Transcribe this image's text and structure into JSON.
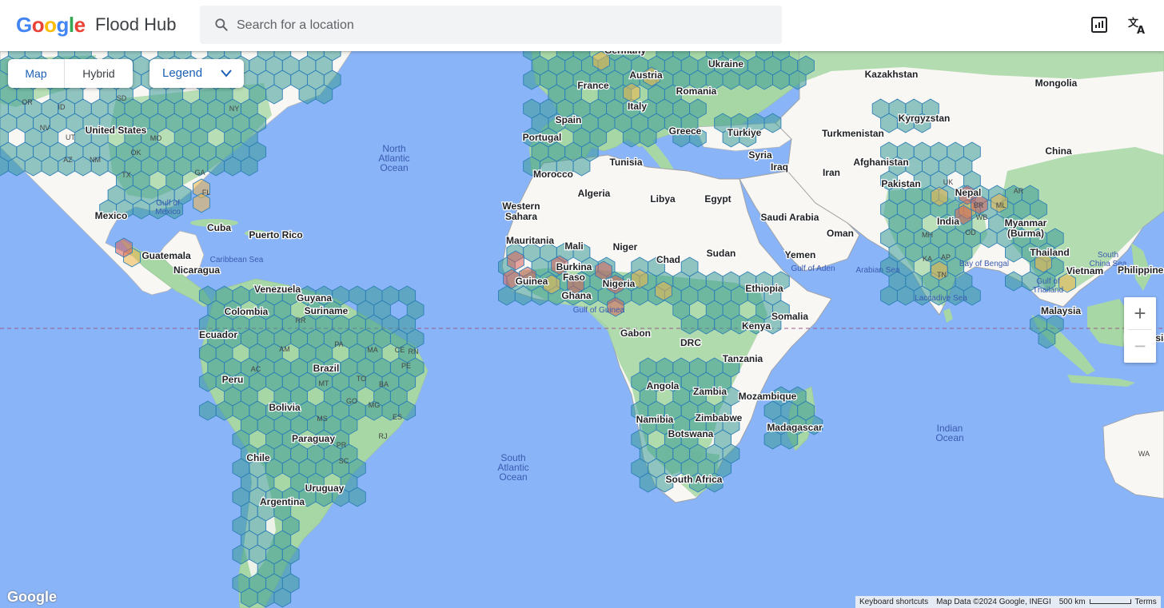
{
  "header": {
    "logo_letters": [
      "G",
      "o",
      "o",
      "g",
      "l",
      "e"
    ],
    "logo_colors": [
      "#4285F4",
      "#EA4335",
      "#FBBC05",
      "#4285F4",
      "#34A853",
      "#EA4335"
    ],
    "product_name": "Flood Hub",
    "search_placeholder": "Search for a location",
    "icons": {
      "search": "search-icon",
      "report": "report-icon",
      "translate": "translate-icon"
    }
  },
  "map_controls": {
    "map_type_options": [
      "Map",
      "Hybrid"
    ],
    "selected_map_type": "Map",
    "legend_label": "Legend",
    "zoom_in_label": "+",
    "zoom_out_label": "−"
  },
  "map_labels": {
    "oceans": [
      "North Atlantic Ocean",
      "South Atlantic Ocean",
      "Indian Ocean"
    ],
    "seas": [
      "Gulf of Mexico",
      "Caribbean Sea",
      "Gulf of Guinea",
      "Arabian Sea",
      "Bay of Bengal",
      "Laccadive Sea",
      "Gulf of Aden",
      "South China Sea",
      "Gulf of Thailand"
    ],
    "countries": [
      "Germany",
      "Ukraine",
      "Kazakhstan",
      "Mongolia",
      "France",
      "Austria",
      "Romania",
      "Italy",
      "Kyrgyzstan",
      "Spain",
      "Portugal",
      "Greece",
      "Türkiye",
      "Turkmenistan",
      "China",
      "Syria",
      "Iraq",
      "Iran",
      "Afghanistan",
      "Morocco",
      "Tunisia",
      "Algeria",
      "Libya",
      "Egypt",
      "Pakistan",
      "Nepal",
      "Western Sahara",
      "Saudi Arabia",
      "India",
      "Myanmar (Burma)",
      "Oman",
      "Mauritania",
      "Mali",
      "Niger",
      "Chad",
      "Sudan",
      "Yemen",
      "Thailand",
      "Vietnam",
      "Philippines",
      "Burkina Faso",
      "Guinea",
      "Nigeria",
      "Ghana",
      "Ethiopia",
      "Somalia",
      "Malaysia",
      "Kenya",
      "Gabon",
      "DRC",
      "Tanzania",
      "Indonesia",
      "Angola",
      "Zambia",
      "Mozambique",
      "Namibia",
      "Zimbabwe",
      "Madagascar",
      "Botswana",
      "South Africa",
      "United States",
      "Mexico",
      "Cuba",
      "Puerto Rico",
      "Guatemala",
      "Nicaragua",
      "Venezuela",
      "Guyana",
      "Suriname",
      "Colombia",
      "Ecuador",
      "Peru",
      "Brazil",
      "Bolivia",
      "Paraguay",
      "Chile",
      "Uruguay",
      "Argentina"
    ],
    "regions": [
      "OR",
      "ID",
      "SD",
      "NY",
      "NV",
      "UT",
      "AZ",
      "NM",
      "OK",
      "MO",
      "TX",
      "GA",
      "FL",
      "AM",
      "AC",
      "PA",
      "MA",
      "CE",
      "RN",
      "PE",
      "TO",
      "BA",
      "MT",
      "GO",
      "MG",
      "ES",
      "MS",
      "PR",
      "SC",
      "RJ",
      "RR",
      "UK",
      "BR",
      "WB",
      "ML",
      "AR",
      "MH",
      "OD",
      "KA",
      "AP",
      "TN",
      "WA"
    ]
  },
  "footer": {
    "google_mark": "Google",
    "keyboard_shortcuts": "Keyboard shortcuts",
    "map_data": "Map Data ©2024 Google, INEGI",
    "scale": "500 km",
    "terms": "Terms"
  },
  "colors": {
    "water": "#8ab4f8",
    "land": "#f8f7f3",
    "vegetation": "#a7d7a5",
    "hex_normal": "#3a9a95",
    "hex_warning": "#f0b64a",
    "hex_danger": "#d9605a",
    "borders": "#a0a0a0"
  }
}
